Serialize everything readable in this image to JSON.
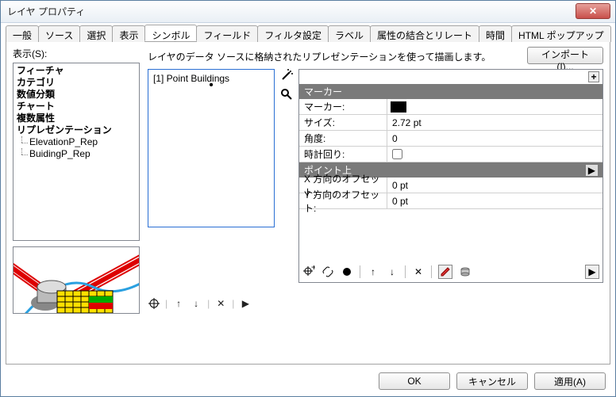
{
  "window": {
    "title": "レイヤ プロパティ"
  },
  "tabs": [
    "一般",
    "ソース",
    "選択",
    "表示",
    "シンボル",
    "フィールド",
    "フィルタ設定",
    "ラベル",
    "属性の結合とリレート",
    "時間",
    "HTML ポップアップ"
  ],
  "active_tab": "シンボル",
  "display_label": "表示(S):",
  "tree": {
    "items": [
      "フィーチャ",
      "カテゴリ",
      "数値分類",
      "チャート",
      "複数属性",
      "リプレゼンテーション"
    ],
    "children": [
      "ElevationP_Rep",
      "BuidingP_Rep"
    ]
  },
  "description": "レイヤのデータ ソースに格納されたリプレゼンテーションを使って描画します。",
  "import_label": "インポート(I)...",
  "rule": {
    "label": "[1] Point Buildings"
  },
  "marker_section": "マーカー",
  "point_section": "ポイント上",
  "props": {
    "marker_label": "マーカー:",
    "size_label": "サイズ:",
    "size_value": "2.72 pt",
    "angle_label": "角度:",
    "angle_value": "0",
    "clockwise_label": "時計回り:",
    "xoff_label": "X 方向のオフセット:",
    "xoff_value": "0 pt",
    "yoff_label": "Y 方向のオフセット:",
    "yoff_value": "0 pt"
  },
  "footer": {
    "ok": "OK",
    "cancel": "キャンセル",
    "apply": "適用(A)"
  }
}
